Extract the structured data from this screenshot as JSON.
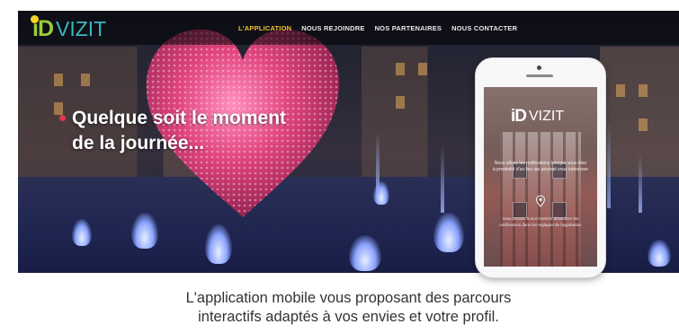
{
  "brand": {
    "logo_id": "iD",
    "logo_vizit": "VIZIT",
    "colors": {
      "id_green": "#9ccc3a",
      "vizit_teal": "#39b8c0",
      "bulb_yellow": "#f5d327",
      "nav_active": "#f3c12b"
    }
  },
  "nav": {
    "items": [
      {
        "label": "L'APPLICATION",
        "active": true
      },
      {
        "label": "NOUS REJOINDRE",
        "active": false
      },
      {
        "label": "NOS PARTENAIRES",
        "active": false
      },
      {
        "label": "NOUS CONTACTER",
        "active": false
      }
    ]
  },
  "hero": {
    "headline_line1": "Quelque soit le moment",
    "headline_line2": "de la journée..."
  },
  "phone": {
    "logo_id": "iD",
    "logo_vizit": "VIZIT",
    "text1": "Nous allons les notifications lorsque vous êtes à proximité d'un lieu qui pourrait vous intéresser",
    "text2": "Vous pouvez à tout moment désactiver les notifications dans les réglages de l'application"
  },
  "tagline": {
    "line1": "L'application mobile vous proposant des parcours",
    "line2": "interactifs adaptés à vos envies et votre profil."
  },
  "icons": [
    "lightbulb-icon",
    "location-pin-icon",
    "heart-sculpture"
  ]
}
